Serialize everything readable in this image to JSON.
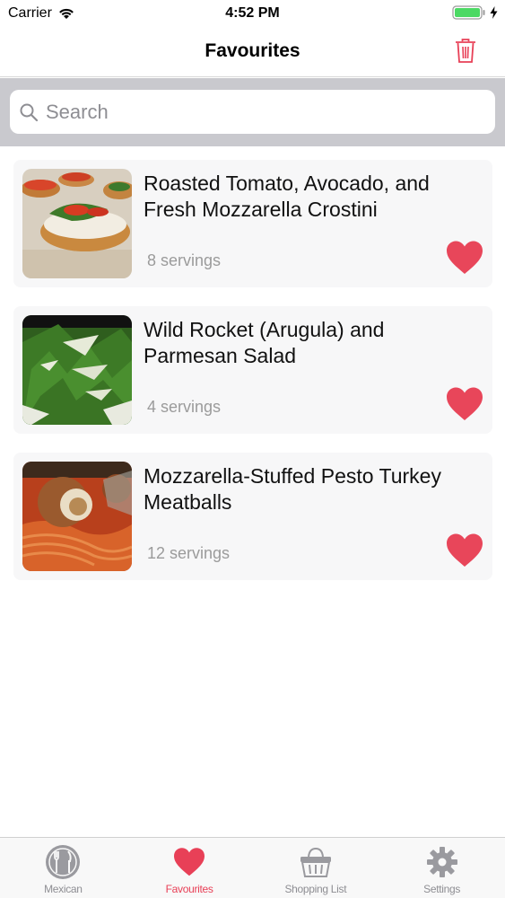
{
  "status_bar": {
    "carrier": "Carrier",
    "time": "4:52 PM"
  },
  "nav": {
    "title": "Favourites",
    "trash_icon": "trash-icon"
  },
  "search": {
    "placeholder": "Search",
    "value": ""
  },
  "recipes": [
    {
      "title": "Roasted Tomato, Avocado, and Fresh Mozzarella Crostini",
      "servings": "8 servings",
      "favourite": true
    },
    {
      "title": "Wild Rocket (Arugula) and Parmesan Salad",
      "servings": "4 servings",
      "favourite": true
    },
    {
      "title": "Mozzarella-Stuffed Pesto Turkey Meatballs",
      "servings": "12 servings",
      "favourite": true
    }
  ],
  "tabs": [
    {
      "label": "Mexican",
      "icon": "plate-cutlery-icon",
      "active": false
    },
    {
      "label": "Favourites",
      "icon": "heart-icon",
      "active": true
    },
    {
      "label": "Shopping List",
      "icon": "basket-icon",
      "active": false
    },
    {
      "label": "Settings",
      "icon": "gear-icon",
      "active": false
    }
  ],
  "colors": {
    "accent": "#e84057",
    "heart": "#e8465a",
    "inactive": "#8e8e93",
    "battery": "#4cd964"
  }
}
